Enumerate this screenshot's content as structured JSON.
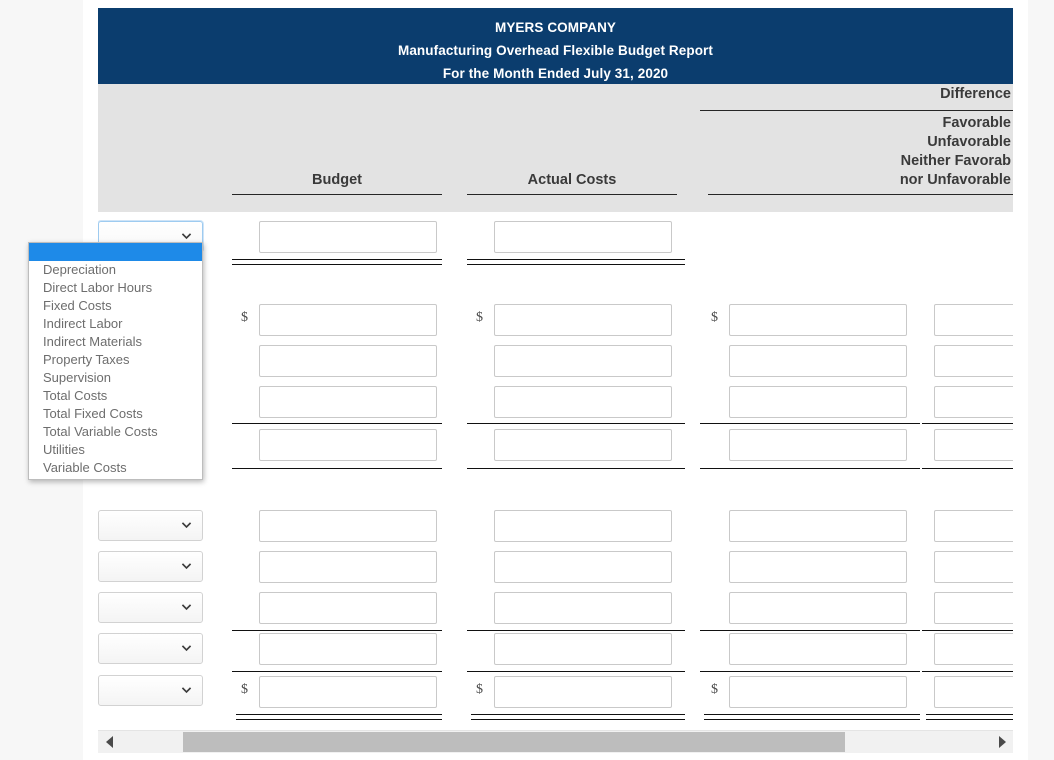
{
  "report": {
    "company": "MYERS COMPANY",
    "title": "Manufacturing Overhead Flexible Budget Report",
    "period": "For the Month Ended July 31, 2020"
  },
  "columns": {
    "budget": "Budget",
    "actual": "Actual Costs",
    "difference": {
      "heading": "Difference",
      "line1": "Favorable",
      "line2": "Unfavorable",
      "line3": "Neither Favorab",
      "line4": "nor Unfavorable"
    }
  },
  "symbols": {
    "dollar": "$",
    "chevron_down": "chevron-down-icon",
    "scroll_left": "triangle-left-icon",
    "scroll_right": "triangle-right-icon"
  },
  "dropdown": {
    "open": true,
    "selected": "",
    "highlight_color": "#1e8ae8",
    "options": [
      "",
      "Depreciation",
      "Direct Labor Hours",
      "Fixed Costs",
      "Indirect Labor",
      "Indirect Materials",
      "Property Taxes",
      "Supervision",
      "Total Costs",
      "Total Fixed Costs",
      "Total Variable Costs",
      "Utilities",
      "Variable Costs"
    ]
  },
  "row_selects": [
    {
      "value": ""
    },
    {
      "value": ""
    },
    {
      "value": ""
    },
    {
      "value": ""
    },
    {
      "value": ""
    },
    {
      "value": ""
    }
  ],
  "cells": {
    "value": "",
    "placeholder": ""
  },
  "colors": {
    "title_band": "#0b3d6e",
    "header_band": "#e3e3e3",
    "rule": "#111111",
    "page_background": "#f7f7f7",
    "scroll_thumb": "#bdbdbd"
  },
  "scrollbar": {
    "orientation": "horizontal",
    "thumb_position_percent": 8,
    "thumb_width_percent": 77
  }
}
